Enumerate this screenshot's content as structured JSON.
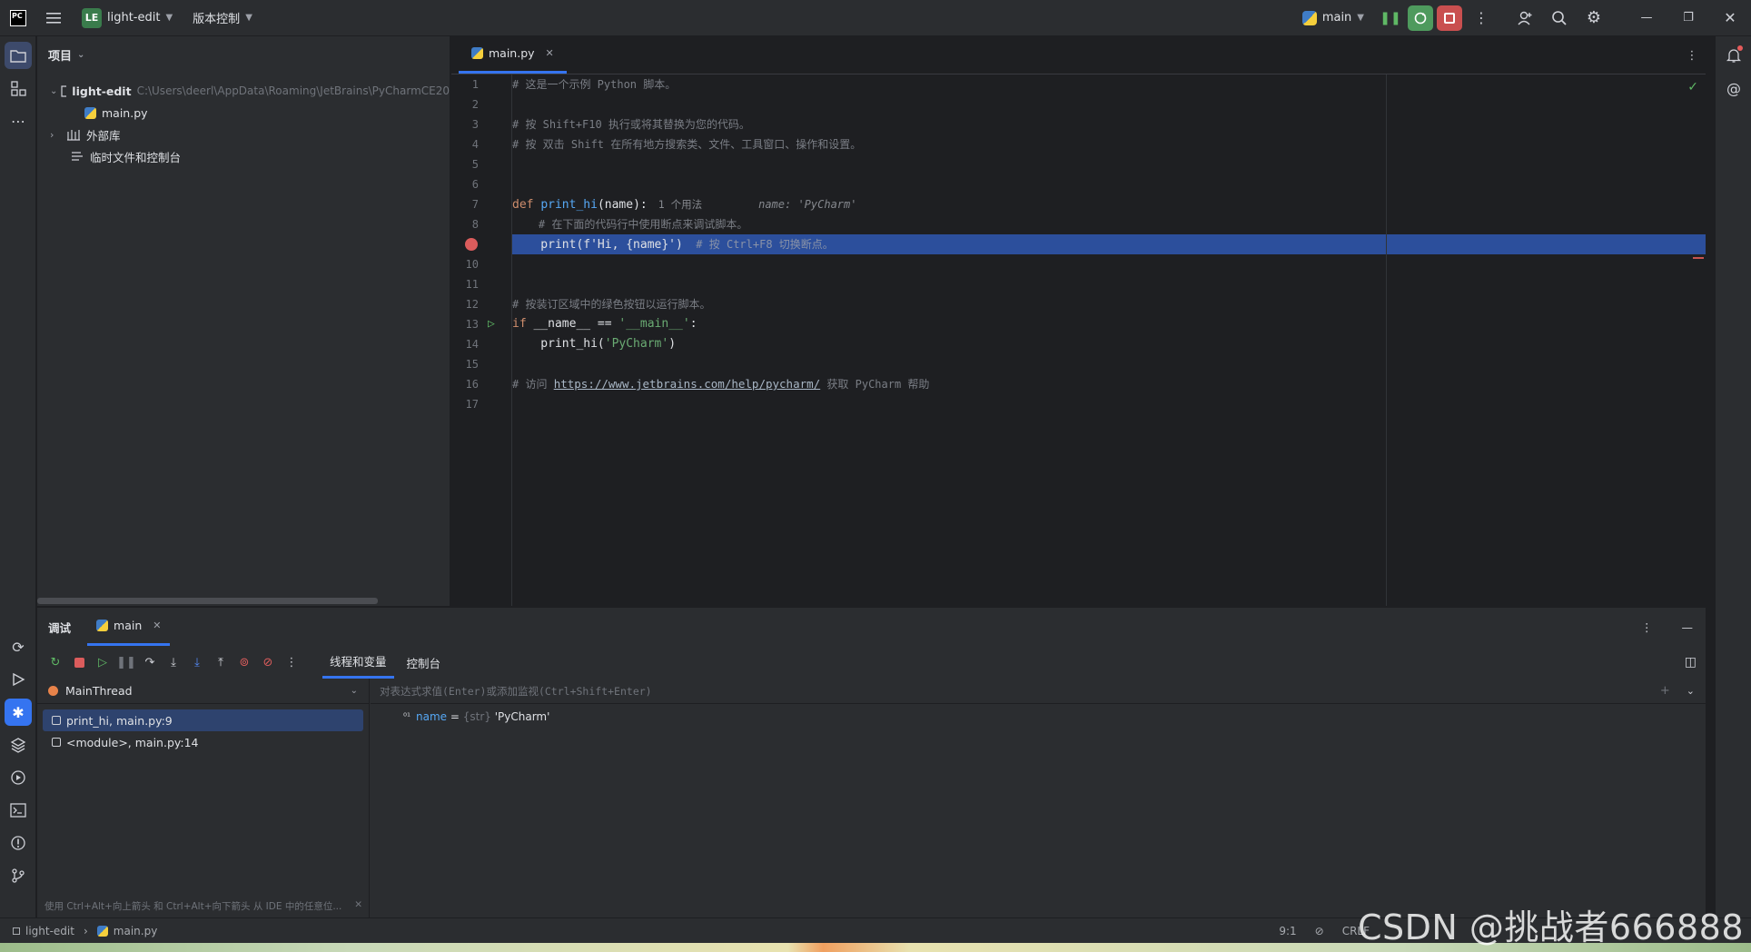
{
  "titlebar": {
    "project_badge": "LE",
    "project_name": "light-edit",
    "vcs_label": "版本控制",
    "run_config": "main"
  },
  "project_panel": {
    "header": "项目",
    "root_name": "light-edit",
    "root_path": "C:\\Users\\deerl\\AppData\\Roaming\\JetBrains\\PyCharmCE20",
    "file": "main.py",
    "external_libs": "外部库",
    "scratches": "临时文件和控制台"
  },
  "editor": {
    "tab_label": "main.py",
    "line_numbers": [
      "1",
      "2",
      "3",
      "4",
      "5",
      "6",
      "7",
      "8",
      "9",
      "10",
      "11",
      "12",
      "13",
      "14",
      "15",
      "16",
      "17"
    ],
    "lines": {
      "l1": "# 这是一个示例 Python 脚本。",
      "l3": "# 按 Shift+F10 执行或将其替换为您的代码。",
      "l4": "# 按 双击 Shift 在所有地方搜索类、文件、工具窗口、操作和设置。",
      "l7_def": "def ",
      "l7_fn": "print_hi",
      "l7_rest": "(name):",
      "l7_usage": "1 个用法",
      "l7_inlay": "name: 'PyCharm'",
      "l8": "    # 在下面的代码行中使用断点来调试脚本。",
      "l9_code": "    print(f'Hi, {name}')",
      "l9_cmt": "  # 按 Ctrl+F8 切换断点。",
      "l12": "# 按装订区域中的绿色按钮以运行脚本。",
      "l13_if": "if ",
      "l13_mid": "__name__ == ",
      "l13_str": "'__main__'",
      "l13_end": ":",
      "l14_a": "    print_hi(",
      "l14_str": "'PyCharm'",
      "l14_b": ")",
      "l16_a": "# 访问 ",
      "l16_link": "https://www.jetbrains.com/help/pycharm/",
      "l16_b": " 获取 PyCharm 帮助"
    }
  },
  "debug": {
    "tab_debug": "调试",
    "tab_main": "main",
    "subtab_threads": "线程和变量",
    "subtab_console": "控制台",
    "thread": "MainThread",
    "frames": [
      "print_hi, main.py:9",
      "<module>, main.py:14"
    ],
    "eval_placeholder": "对表达式求值(Enter)或添加监视(Ctrl+Shift+Enter)",
    "var_name": "name",
    "var_eq": " = ",
    "var_type": "{str}",
    "var_value": " 'PyCharm'",
    "hint": "使用 Ctrl+Alt+向上箭头 和 Ctrl+Alt+向下箭头 从 IDE 中的任意位..."
  },
  "statusbar": {
    "project": "light-edit",
    "file": "main.py",
    "position": "9:1",
    "line_sep": "CRLF"
  },
  "watermark": "CSDN @挑战者666888"
}
